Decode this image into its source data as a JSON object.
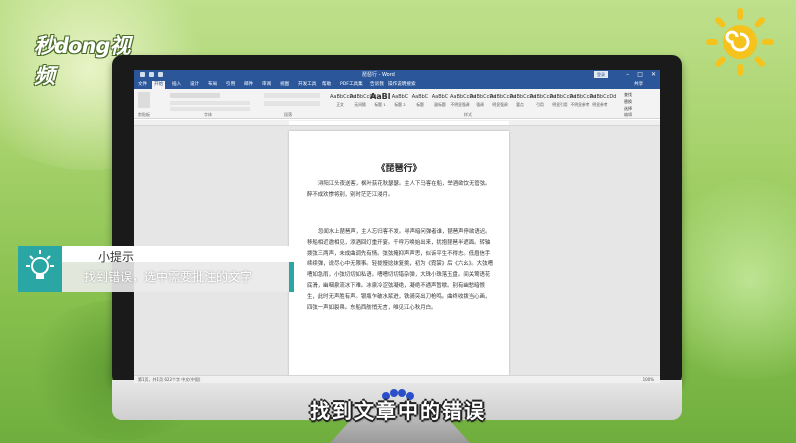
{
  "brand": {
    "logo_text": "秒dong视频"
  },
  "word": {
    "window_title": "琵琶行 - Word",
    "login_label": "登录",
    "tabs": [
      "文件",
      "开始",
      "插入",
      "设计",
      "布局",
      "引用",
      "邮件",
      "审阅",
      "视图",
      "开发工具",
      "帮助",
      "PDF工具集",
      "告诉我",
      "操作说明搜索"
    ],
    "active_tab": "开始",
    "share_label": "共享",
    "groups": [
      "剪贴板",
      "字体",
      "段落",
      "样式",
      "编辑"
    ],
    "styles": [
      {
        "sample": "AaBbCcDd",
        "name": "正文"
      },
      {
        "sample": "AaBbCcDd",
        "name": "无间隔"
      },
      {
        "sample": "AaBl",
        "name": "标题 1"
      },
      {
        "sample": "AaBbC",
        "name": "标题 2"
      },
      {
        "sample": "AaBbC",
        "name": "标题"
      },
      {
        "sample": "AaBbC",
        "name": "副标题"
      },
      {
        "sample": "AaBbCcDd",
        "name": "不明显强调"
      },
      {
        "sample": "AaBbCcDd",
        "name": "强调"
      },
      {
        "sample": "AaBbCcDd",
        "name": "明显强调"
      },
      {
        "sample": "AaBbCcDd",
        "name": "要点"
      },
      {
        "sample": "AaBbCcDd",
        "name": "引用"
      },
      {
        "sample": "AaBbCcDd",
        "name": "明显引用"
      },
      {
        "sample": "AaBbCcDd",
        "name": "不明显参考"
      },
      {
        "sample": "AaBbCcDd",
        "name": "明显参考"
      }
    ],
    "editing": [
      "查找",
      "替换",
      "选择"
    ],
    "document": {
      "title": "《琵琶行》",
      "paragraphs": [
        "浔阳江头夜送客，枫叶荻花秋瑟瑟。主人下马客在船，举酒欲饮无管弦。醉不成欢惨将别，别时茫茫江浸月。",
        "忽闻水上琵琶声，主人忘归客不发。寻声暗问弹者谁，琵琶声停欲语迟。移船相近邀相见，添酒回灯重开宴。千呼万唤始出来，犹抱琵琶半遮面。转轴拨弦三两声，未成曲调先有情。弦弦掩抑声声思，似诉平生不得志。低眉信手续续弹，说尽心中无限事。轻拢慢捻抹复挑，初为《霓裳》后《六幺》。大弦嘈嘈如急雨，小弦切切如私语。嘈嘈切切错杂弹，大珠小珠落玉盘。间关莺语花底滑，幽咽泉流冰下难。冰泉冷涩弦凝绝，凝绝不通声暂歇。别有幽愁暗恨生，此时无声胜有声。银瓶乍破水浆迸，铁骑突出刀枪鸣。曲终收拨当心画，四弦一声如裂帛。东船西舫悄无言，唯见江心秋月白。"
      ]
    },
    "status": "第1页，共1页  622个字  中文(中国)",
    "zoom": "100%"
  },
  "tip": {
    "heading": "小提示",
    "text": "找到错误，选中需要批注的文字"
  },
  "subtitle": "找到文章中的错误",
  "colors": {
    "word_blue": "#2b579a",
    "tip_teal": "#2aa6a4",
    "highlight": "#f4c7c3"
  }
}
